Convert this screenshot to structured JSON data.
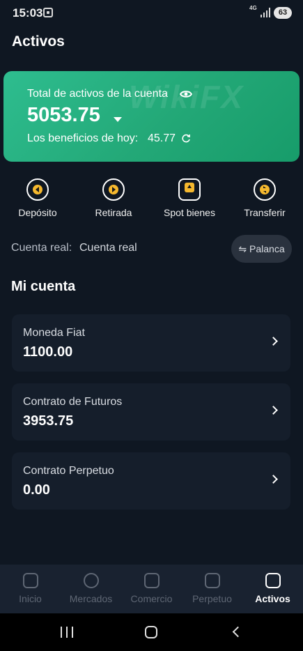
{
  "status_bar": {
    "time": "15:03",
    "network": "4G",
    "battery": "63"
  },
  "header": {
    "title": "Activos"
  },
  "total_card": {
    "label": "Total de activos de la cuenta",
    "total": "5053.75",
    "profit_label": "Los beneficios de hoy:",
    "profit_value": "45.77",
    "watermark": "WikiFX"
  },
  "actions": [
    {
      "label": "Depósito",
      "icon": "deposit-icon"
    },
    {
      "label": "Retirada",
      "icon": "withdraw-icon"
    },
    {
      "label": "Spot bienes",
      "icon": "spot-icon"
    },
    {
      "label": "Transferir",
      "icon": "transfer-icon"
    }
  ],
  "account": {
    "label": "Cuenta real:",
    "value": "Cuenta real",
    "leverage_label": "⇋ Palanca"
  },
  "section": {
    "title": "Mi cuenta"
  },
  "accounts": [
    {
      "name": "Moneda Fiat",
      "amount": "1100.00"
    },
    {
      "name": "Contrato de Futuros",
      "amount": "3953.75"
    },
    {
      "name": "Contrato Perpetuo",
      "amount": "0.00"
    }
  ],
  "nav": [
    {
      "label": "Inicio",
      "icon": "home-icon"
    },
    {
      "label": "Mercados",
      "icon": "markets-icon"
    },
    {
      "label": "Comercio",
      "icon": "trade-icon"
    },
    {
      "label": "Perpetuo",
      "icon": "perpetual-icon"
    },
    {
      "label": "Activos",
      "icon": "wallet-icon",
      "active": true
    }
  ],
  "colors": {
    "background": "#0f1722",
    "accent_green": "#23a877",
    "action_yellow": "#f5b82e",
    "nav_bar": "#192230"
  }
}
